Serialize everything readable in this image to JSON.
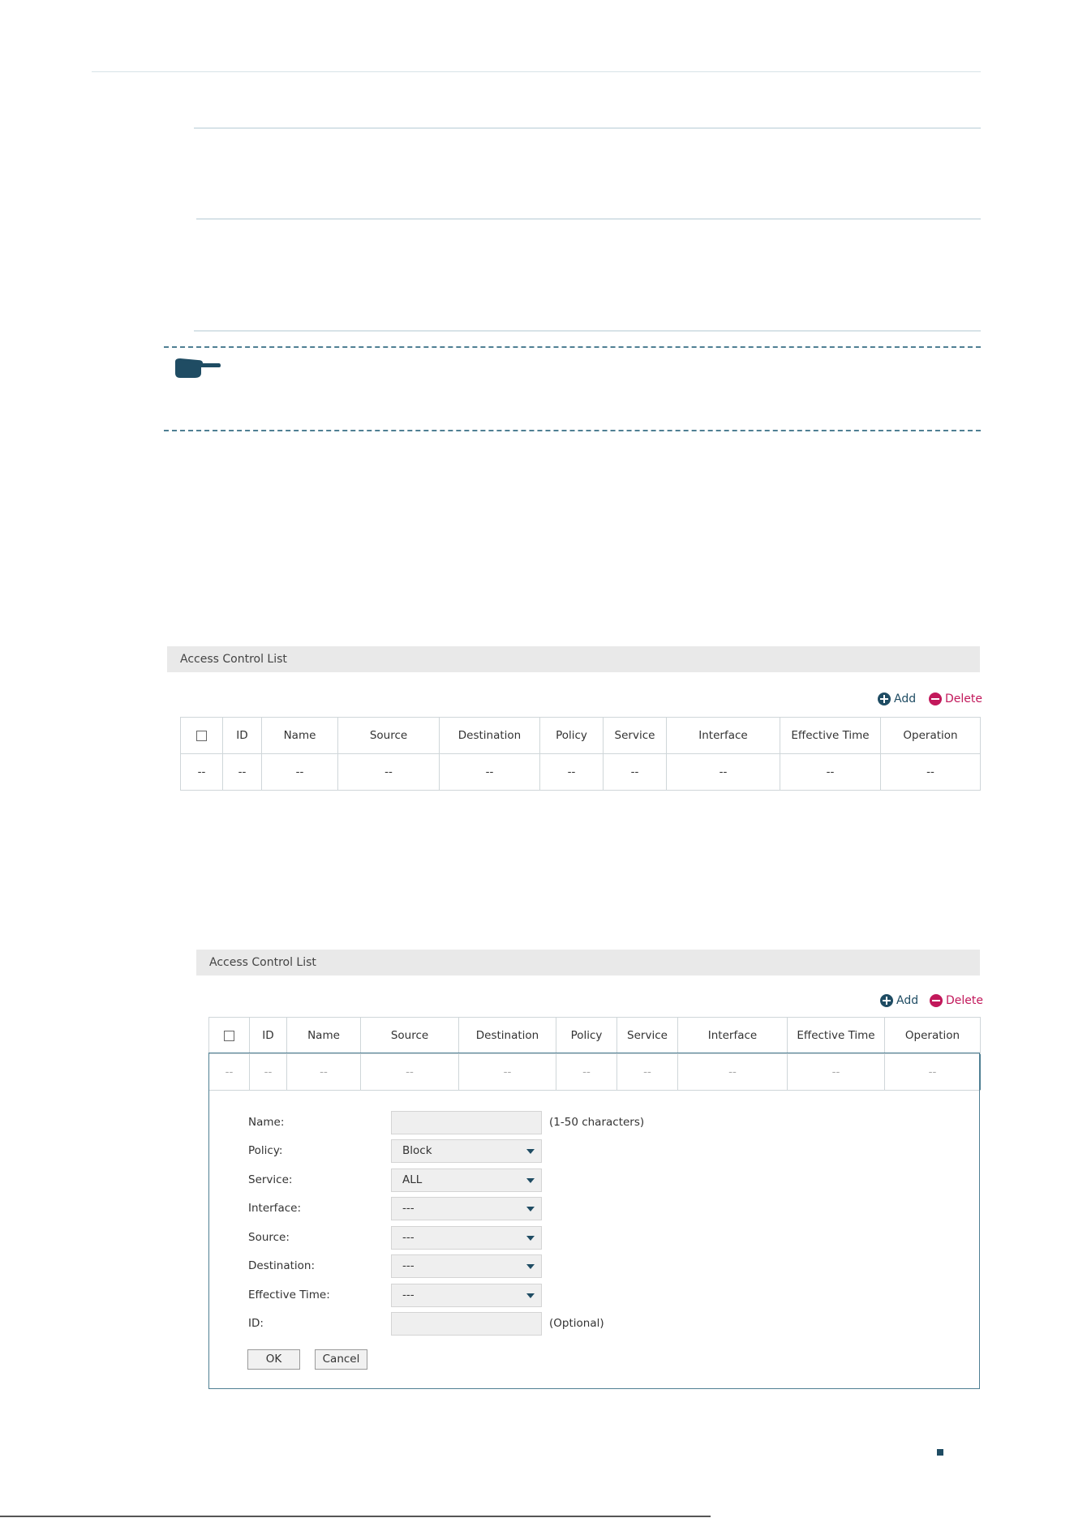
{
  "panel1": {
    "title": "Access Control List",
    "add_label": "Add",
    "delete_label": "Delete",
    "columns": [
      "ID",
      "Name",
      "Source",
      "Destination",
      "Policy",
      "Service",
      "Interface",
      "Effective Time",
      "Operation"
    ],
    "row": [
      "--",
      "--",
      "--",
      "--",
      "--",
      "--",
      "--",
      "--",
      "--",
      "--"
    ]
  },
  "panel2": {
    "title": "Access Control List",
    "add_label": "Add",
    "delete_label": "Delete",
    "columns": [
      "ID",
      "Name",
      "Source",
      "Destination",
      "Policy",
      "Service",
      "Interface",
      "Effective Time",
      "Operation"
    ],
    "row": [
      "--",
      "--",
      "--",
      "--",
      "--",
      "--",
      "--",
      "--",
      "--",
      "--"
    ],
    "form": {
      "name_label": "Name:",
      "name_value": "",
      "name_hint": "(1-50 characters)",
      "policy_label": "Policy:",
      "policy_value": "Block",
      "service_label": "Service:",
      "service_value": "ALL",
      "interface_label": "Interface:",
      "interface_value": "---",
      "source_label": "Source:",
      "source_value": "---",
      "destination_label": "Destination:",
      "destination_value": "---",
      "effective_time_label": "Effective Time:",
      "effective_time_value": "---",
      "id_label": "ID:",
      "id_value": "",
      "id_hint": "(Optional)",
      "ok_label": "OK",
      "cancel_label": "Cancel"
    }
  },
  "colors": {
    "accent": "#1f4c63",
    "delete": "#c2185b",
    "rule": "#d8e3e8",
    "dash": "#4f7f93"
  }
}
